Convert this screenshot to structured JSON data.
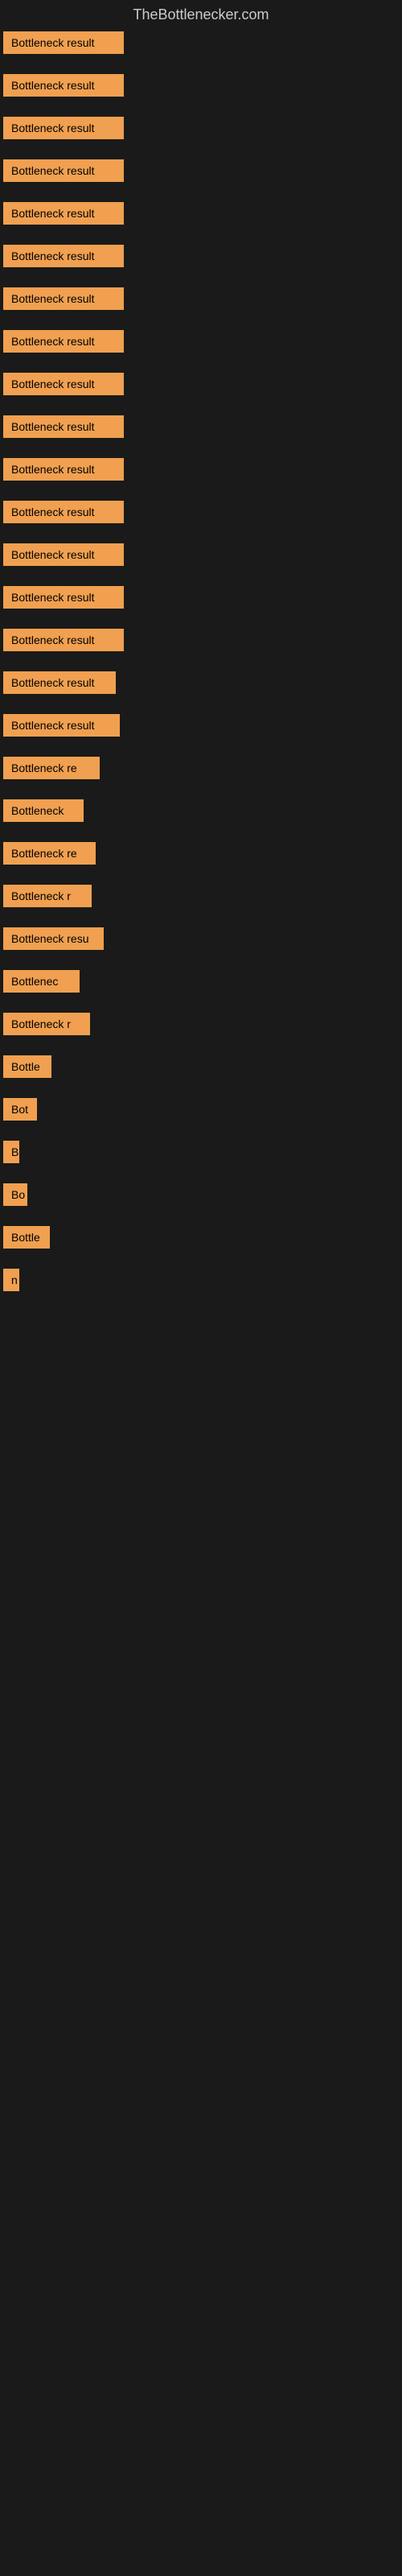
{
  "site": {
    "title": "TheBottlenecker.com"
  },
  "items": [
    {
      "label": "Bottleneck result",
      "width": 150
    },
    {
      "label": "Bottleneck result",
      "width": 150
    },
    {
      "label": "Bottleneck result",
      "width": 150
    },
    {
      "label": "Bottleneck result",
      "width": 150
    },
    {
      "label": "Bottleneck result",
      "width": 150
    },
    {
      "label": "Bottleneck result",
      "width": 150
    },
    {
      "label": "Bottleneck result",
      "width": 150
    },
    {
      "label": "Bottleneck result",
      "width": 150
    },
    {
      "label": "Bottleneck result",
      "width": 150
    },
    {
      "label": "Bottleneck result",
      "width": 150
    },
    {
      "label": "Bottleneck result",
      "width": 150
    },
    {
      "label": "Bottleneck result",
      "width": 150
    },
    {
      "label": "Bottleneck result",
      "width": 150
    },
    {
      "label": "Bottleneck result",
      "width": 150
    },
    {
      "label": "Bottleneck result",
      "width": 150
    },
    {
      "label": "Bottleneck result",
      "width": 140
    },
    {
      "label": "Bottleneck result",
      "width": 145
    },
    {
      "label": "Bottleneck re",
      "width": 120
    },
    {
      "label": "Bottleneck",
      "width": 100
    },
    {
      "label": "Bottleneck re",
      "width": 115
    },
    {
      "label": "Bottleneck r",
      "width": 110
    },
    {
      "label": "Bottleneck resu",
      "width": 125
    },
    {
      "label": "Bottlenec",
      "width": 95
    },
    {
      "label": "Bottleneck r",
      "width": 108
    },
    {
      "label": "Bottle",
      "width": 60
    },
    {
      "label": "Bot",
      "width": 42
    },
    {
      "label": "B",
      "width": 18
    },
    {
      "label": "Bo",
      "width": 30
    },
    {
      "label": "Bottle",
      "width": 58
    },
    {
      "label": "n",
      "width": 14
    }
  ]
}
